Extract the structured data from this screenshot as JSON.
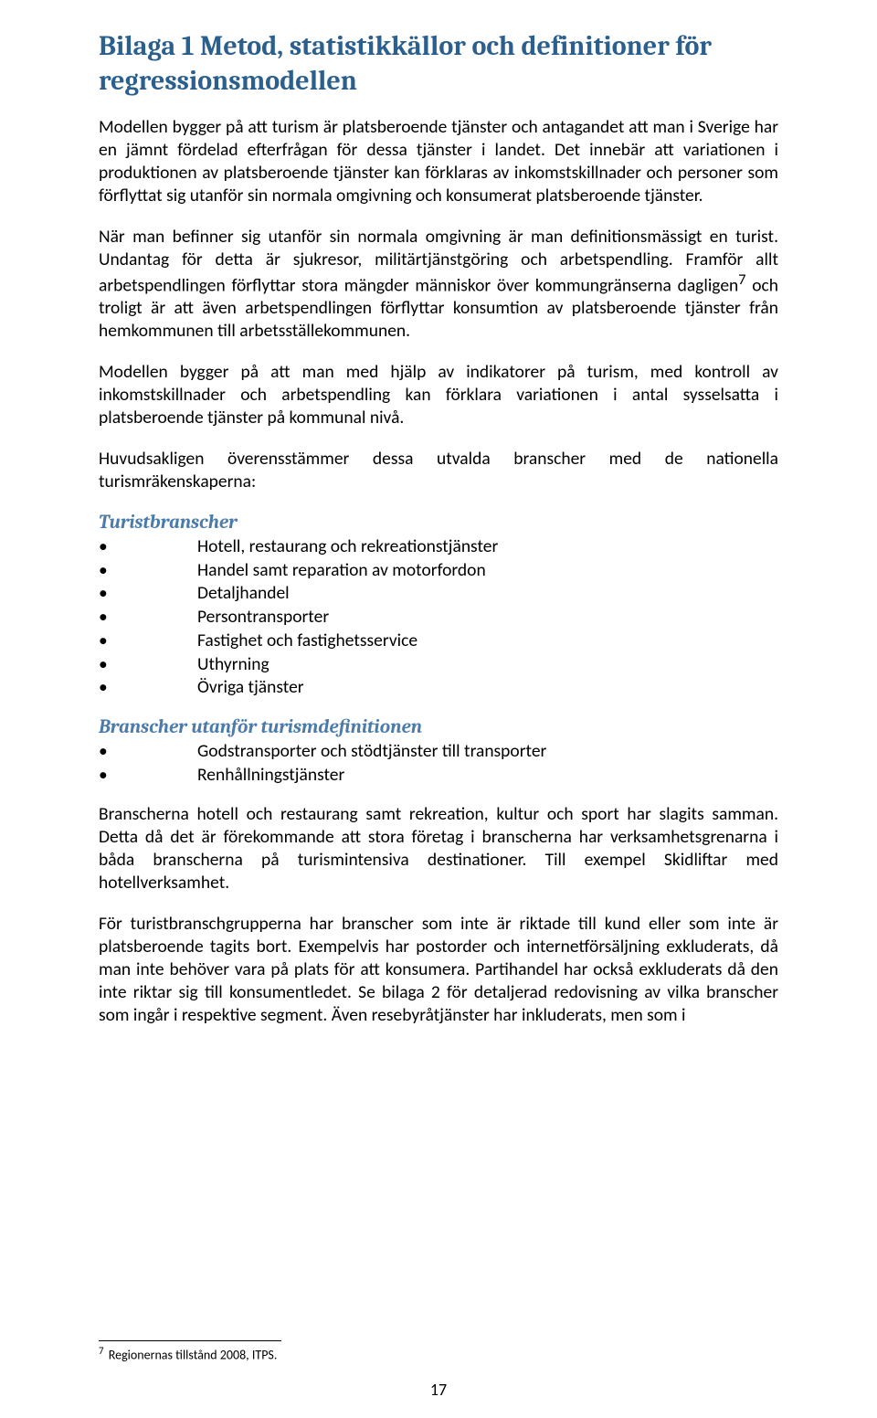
{
  "title": "Bilaga 1 Metod, statistikkällor och definitioner för regressionsmodellen",
  "p1": "Modellen bygger på att turism är platsberoende tjänster och antagandet att man i Sverige har en jämnt fördelad efterfrågan för dessa tjänster i landet. Det innebär att variationen i produktionen av platsberoende tjänster kan förklaras av inkomstskillnader och personer som förflyttat sig utanför sin normala omgivning och konsumerat platsberoende tjänster.",
  "p2a": "När man befinner sig utanför sin normala omgivning är man definitionsmässigt en turist. Undantag för detta är sjukresor, militärtjänstgöring och arbetspendling. Framför allt arbetspendlingen förflyttar stora mängder människor över kommungränserna dagligen",
  "p2b": " och troligt är att även arbetspendlingen förflyttar konsumtion av platsberoende tjänster från hemkommunen till arbetsställekommunen.",
  "p3": "Modellen bygger på att man med hjälp av indikatorer på turism, med kontroll av inkomstskillnader och arbetspendling kan förklara variationen i antal sysselsatta i platsberoende tjänster på kommunal nivå.",
  "p4": "Huvudsakligen överensstämmer dessa utvalda branscher med de nationella turismräkenskaperna:",
  "sub1": "Turistbranscher",
  "list1": [
    "Hotell, restaurang och rekreationstjänster",
    "Handel samt reparation av motorfordon",
    "Detaljhandel",
    "Persontransporter",
    "Fastighet och fastighetsservice",
    "Uthyrning",
    "Övriga tjänster"
  ],
  "sub2": "Branscher utanför turismdefinitionen",
  "list2": [
    "Godstransporter och stödtjänster till transporter",
    "Renhållningstjänster"
  ],
  "p5": "Branscherna hotell och restaurang samt rekreation, kultur och sport har slagits samman. Detta då det är förekommande att stora företag i branscherna har verksamhetsgrenarna i båda branscherna på turismintensiva destinationer. Till exempel Skidliftar med hotellverksamhet.",
  "p6": "För turistbranschgrupperna har branscher som inte är riktade till kund eller som inte är platsberoende tagits bort. Exempelvis har postorder och internetförsäljning exkluderats, då man inte behöver vara på plats för att konsumera. Partihandel har också exkluderats då den inte riktar sig till konsumentledet. Se bilaga 2 för detaljerad redovisning av vilka branscher som ingår i respektive segment. Även resebyråtjänster har inkluderats, men som i",
  "fnref": "7",
  "footnote_num": "7",
  "footnote_text": " Regionernas tillstånd 2008, ITPS.",
  "page_number": "17"
}
